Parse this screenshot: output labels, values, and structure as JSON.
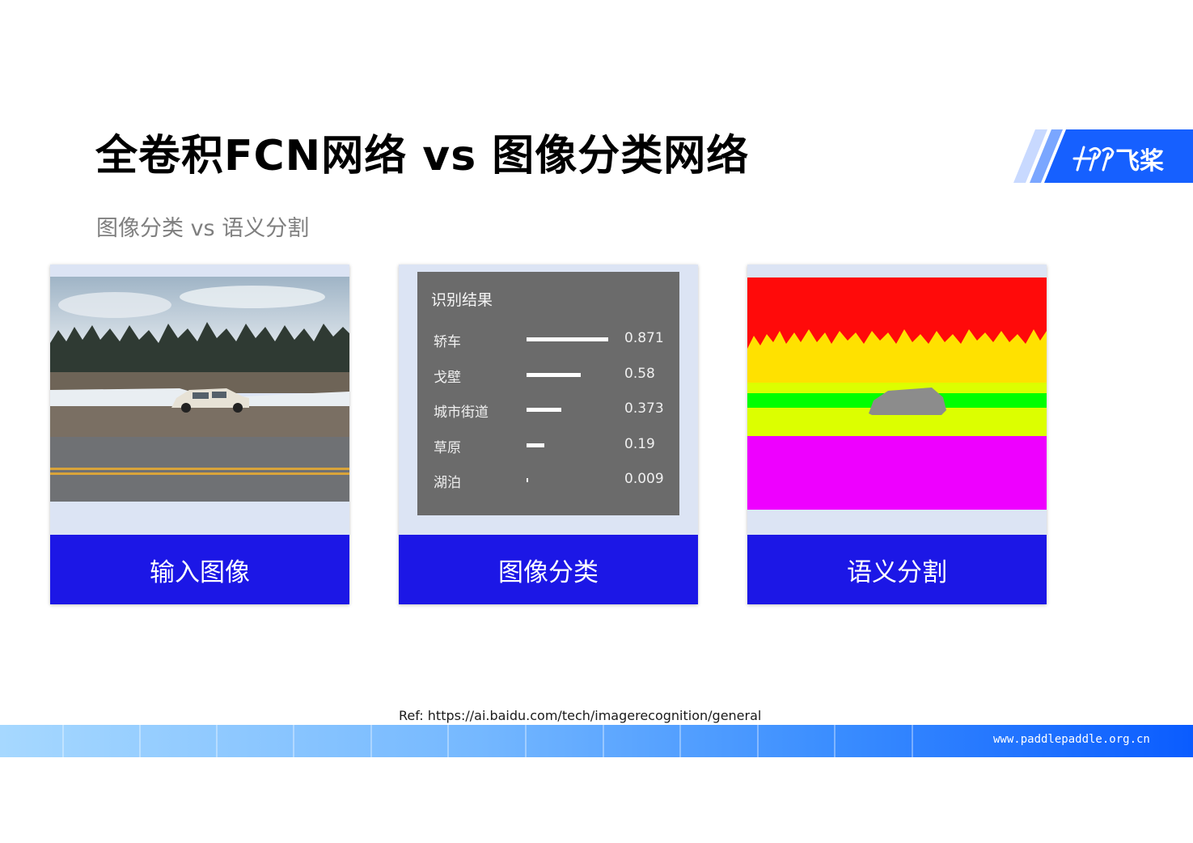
{
  "slide": {
    "title": "全卷积FCN网络 vs 图像分类网络",
    "subtitle": "图像分类 vs 语义分割",
    "ref": "Ref: https://ai.baidu.com/tech/imagerecognition/general",
    "footer_url": "www.paddlepaddle.org.cn"
  },
  "logo": {
    "text": "飞桨",
    "icon": "paddle-logo-icon"
  },
  "panels": [
    {
      "label": "输入图像"
    },
    {
      "label": "图像分类"
    },
    {
      "label": "语义分割"
    }
  ],
  "recognition": {
    "title": "识别结果",
    "results": [
      {
        "label": "轿车",
        "score": 0.871,
        "score_text": "0.871"
      },
      {
        "label": "戈壁",
        "score": 0.58,
        "score_text": "0.58"
      },
      {
        "label": "城市街道",
        "score": 0.373,
        "score_text": "0.373"
      },
      {
        "label": "草原",
        "score": 0.19,
        "score_text": "0.19"
      },
      {
        "label": "湖泊",
        "score": 0.009,
        "score_text": "0.009"
      }
    ]
  },
  "colors": {
    "label_bg": "#1c17e6",
    "panel_bg": "#dce4f4",
    "seg_sky": "#ff0a0a",
    "seg_trees": "#ffe100",
    "seg_grass": "#dcff00",
    "seg_green": "#00ff00",
    "seg_road": "#ee00ff",
    "seg_car": "#8c8c8c"
  }
}
